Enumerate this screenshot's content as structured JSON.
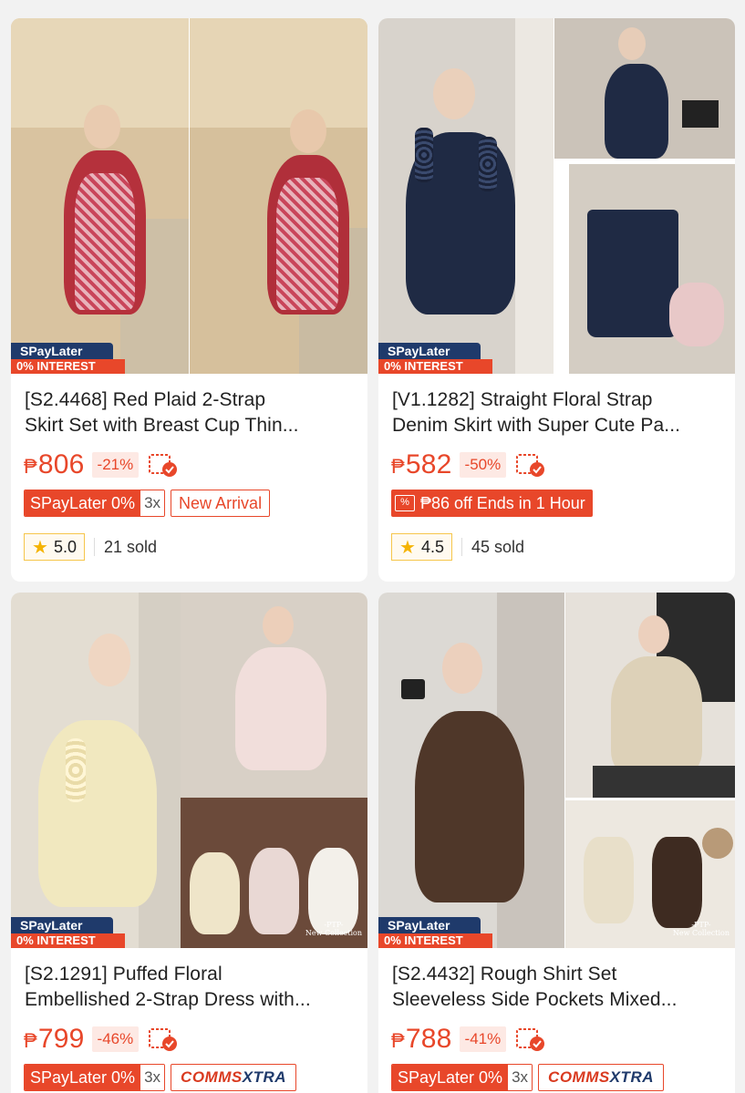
{
  "products": [
    {
      "badge": {
        "top": "SPayLater",
        "bottom": "0% INTEREST"
      },
      "title_line1": "[S2.4468] Red Plaid 2-Strap",
      "title_line2": "Skirt Set with Breast Cup Thin...",
      "currency": "₱",
      "price": "806",
      "discount": "-21%",
      "voucher_icon": "voucher-check-icon",
      "tags": {
        "spaylater": "SPayLater 0%",
        "installments": "3x",
        "outline": "New Arrival"
      },
      "rating": "5.0",
      "sold": "21 sold"
    },
    {
      "badge": {
        "top": "SPayLater",
        "bottom": "0% INTEREST"
      },
      "title_line1": "[V1.1282] Straight Floral Strap",
      "title_line2": "Denim Skirt with Super Cute Pa...",
      "currency": "₱",
      "price": "582",
      "discount": "-50%",
      "voucher_icon": "voucher-check-icon",
      "tags": {
        "flash": "₱86 off Ends in 1 Hour"
      },
      "rating": "4.5",
      "sold": "45 sold"
    },
    {
      "badge": {
        "top": "SPayLater",
        "bottom": "0% INTEREST"
      },
      "watermark": [
        "-PTP-",
        "New Collection"
      ],
      "title_line1": "[S2.1291] Puffed Floral",
      "title_line2": "Embellished 2-Strap Dress with...",
      "currency": "₱",
      "price": "799",
      "discount": "-46%",
      "voucher_icon": "voucher-check-icon",
      "tags": {
        "spaylater": "SPayLater 0%",
        "installments": "3x",
        "comms_a": "COMMS",
        "comms_b": "XTRA"
      }
    },
    {
      "badge": {
        "top": "SPayLater",
        "bottom": "0% INTEREST"
      },
      "watermark": [
        "-PTP-",
        "New Collection"
      ],
      "title_line1": "[S2.4432] Rough Shirt Set",
      "title_line2": "Sleeveless Side Pockets Mixed...",
      "currency": "₱",
      "price": "788",
      "discount": "-41%",
      "voucher_icon": "voucher-check-icon",
      "tags": {
        "spaylater": "SPayLater 0%",
        "installments": "3x",
        "comms_a": "COMMS",
        "comms_b": "XTRA"
      }
    }
  ],
  "colors": {
    "accent": "#e8472a",
    "navy": "#1f3a6b",
    "star": "#f5b301"
  }
}
